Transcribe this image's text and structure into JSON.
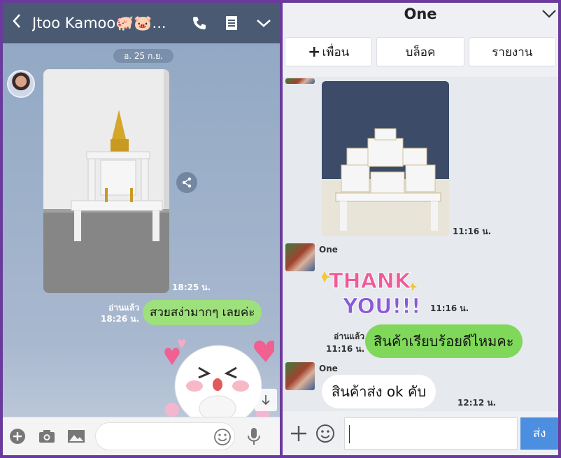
{
  "left": {
    "header": {
      "title": "Jtoo Kamoo🐖🐷...",
      "icons": [
        "back-icon",
        "phone-icon",
        "notes-icon",
        "chevron-down-icon"
      ]
    },
    "date_label": "อ. 25 ก.ย.",
    "messages": {
      "photo_time": "18:25 น.",
      "read_label": "อ่านแล้ว",
      "sent_time": "18:26 น.",
      "sent_text": "สวยสง่ามากๆ เลยค่ะ"
    },
    "footer": {
      "icons": [
        "plus-icon",
        "camera-icon",
        "image-icon",
        "smile-icon",
        "microphone-icon"
      ]
    }
  },
  "right": {
    "header": {
      "title": "One"
    },
    "tabs": [
      {
        "label": "เพื่อน",
        "icon": "plus-icon"
      },
      {
        "label": "บล็อค"
      },
      {
        "label": "รายงาน"
      }
    ],
    "messages": {
      "photo_time": "11:16 น.",
      "sender_name": "One",
      "sticker_text": "THANK YOU!!!",
      "sticker_time": "11:16 น.",
      "read_label": "อ่านแล้ว",
      "sent_time": "11:16 น.",
      "sent_text": "สินค้าเรียบร้อยดีไหมคะ",
      "reply_sender": "One",
      "reply_text": "สินค้าส่ง ok คับ",
      "reply_time": "12:12 น."
    },
    "footer": {
      "send_label": "ส่ง",
      "icons": [
        "plus-icon",
        "smile-icon"
      ]
    }
  },
  "colors": {
    "frame": "#6a3a9c",
    "left_header": "#4a5a72",
    "left_bubble": "#9ee07c",
    "right_bubble_sent": "#80d85a",
    "send_button": "#4c8fe0"
  }
}
